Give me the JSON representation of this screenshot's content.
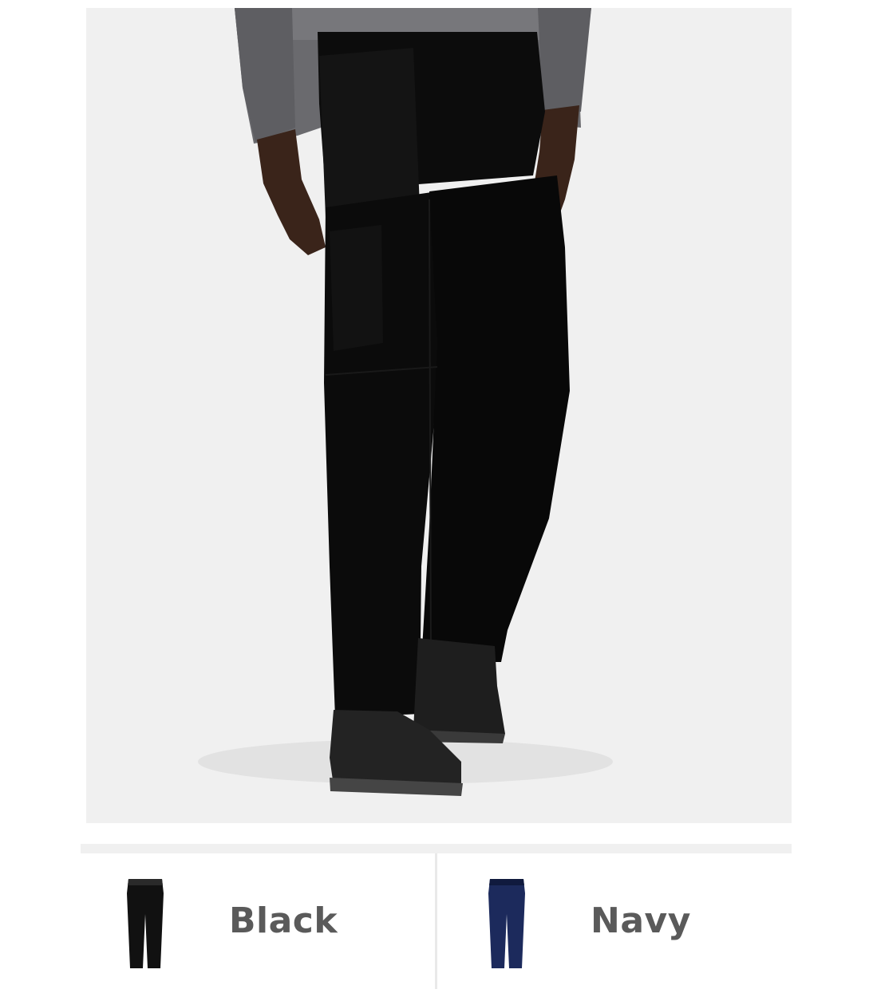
{
  "product_image": {
    "alt": "",
    "background": "#f0f0f0",
    "garment_color": "#0b0b0b"
  },
  "colour_options": [
    {
      "label": "Black",
      "color": "#111111",
      "selected": false
    },
    {
      "label": "Navy",
      "color": "#1c2a5c",
      "selected": false
    }
  ]
}
